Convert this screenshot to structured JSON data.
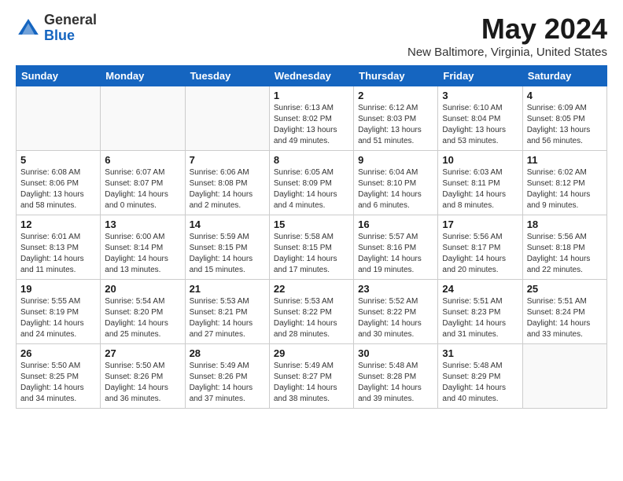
{
  "logo": {
    "general": "General",
    "blue": "Blue"
  },
  "title": "May 2024",
  "subtitle": "New Baltimore, Virginia, United States",
  "days_of_week": [
    "Sunday",
    "Monday",
    "Tuesday",
    "Wednesday",
    "Thursday",
    "Friday",
    "Saturday"
  ],
  "weeks": [
    [
      {
        "num": "",
        "info": ""
      },
      {
        "num": "",
        "info": ""
      },
      {
        "num": "",
        "info": ""
      },
      {
        "num": "1",
        "info": "Sunrise: 6:13 AM\nSunset: 8:02 PM\nDaylight: 13 hours\nand 49 minutes."
      },
      {
        "num": "2",
        "info": "Sunrise: 6:12 AM\nSunset: 8:03 PM\nDaylight: 13 hours\nand 51 minutes."
      },
      {
        "num": "3",
        "info": "Sunrise: 6:10 AM\nSunset: 8:04 PM\nDaylight: 13 hours\nand 53 minutes."
      },
      {
        "num": "4",
        "info": "Sunrise: 6:09 AM\nSunset: 8:05 PM\nDaylight: 13 hours\nand 56 minutes."
      }
    ],
    [
      {
        "num": "5",
        "info": "Sunrise: 6:08 AM\nSunset: 8:06 PM\nDaylight: 13 hours\nand 58 minutes."
      },
      {
        "num": "6",
        "info": "Sunrise: 6:07 AM\nSunset: 8:07 PM\nDaylight: 14 hours\nand 0 minutes."
      },
      {
        "num": "7",
        "info": "Sunrise: 6:06 AM\nSunset: 8:08 PM\nDaylight: 14 hours\nand 2 minutes."
      },
      {
        "num": "8",
        "info": "Sunrise: 6:05 AM\nSunset: 8:09 PM\nDaylight: 14 hours\nand 4 minutes."
      },
      {
        "num": "9",
        "info": "Sunrise: 6:04 AM\nSunset: 8:10 PM\nDaylight: 14 hours\nand 6 minutes."
      },
      {
        "num": "10",
        "info": "Sunrise: 6:03 AM\nSunset: 8:11 PM\nDaylight: 14 hours\nand 8 minutes."
      },
      {
        "num": "11",
        "info": "Sunrise: 6:02 AM\nSunset: 8:12 PM\nDaylight: 14 hours\nand 9 minutes."
      }
    ],
    [
      {
        "num": "12",
        "info": "Sunrise: 6:01 AM\nSunset: 8:13 PM\nDaylight: 14 hours\nand 11 minutes."
      },
      {
        "num": "13",
        "info": "Sunrise: 6:00 AM\nSunset: 8:14 PM\nDaylight: 14 hours\nand 13 minutes."
      },
      {
        "num": "14",
        "info": "Sunrise: 5:59 AM\nSunset: 8:15 PM\nDaylight: 14 hours\nand 15 minutes."
      },
      {
        "num": "15",
        "info": "Sunrise: 5:58 AM\nSunset: 8:15 PM\nDaylight: 14 hours\nand 17 minutes."
      },
      {
        "num": "16",
        "info": "Sunrise: 5:57 AM\nSunset: 8:16 PM\nDaylight: 14 hours\nand 19 minutes."
      },
      {
        "num": "17",
        "info": "Sunrise: 5:56 AM\nSunset: 8:17 PM\nDaylight: 14 hours\nand 20 minutes."
      },
      {
        "num": "18",
        "info": "Sunrise: 5:56 AM\nSunset: 8:18 PM\nDaylight: 14 hours\nand 22 minutes."
      }
    ],
    [
      {
        "num": "19",
        "info": "Sunrise: 5:55 AM\nSunset: 8:19 PM\nDaylight: 14 hours\nand 24 minutes."
      },
      {
        "num": "20",
        "info": "Sunrise: 5:54 AM\nSunset: 8:20 PM\nDaylight: 14 hours\nand 25 minutes."
      },
      {
        "num": "21",
        "info": "Sunrise: 5:53 AM\nSunset: 8:21 PM\nDaylight: 14 hours\nand 27 minutes."
      },
      {
        "num": "22",
        "info": "Sunrise: 5:53 AM\nSunset: 8:22 PM\nDaylight: 14 hours\nand 28 minutes."
      },
      {
        "num": "23",
        "info": "Sunrise: 5:52 AM\nSunset: 8:22 PM\nDaylight: 14 hours\nand 30 minutes."
      },
      {
        "num": "24",
        "info": "Sunrise: 5:51 AM\nSunset: 8:23 PM\nDaylight: 14 hours\nand 31 minutes."
      },
      {
        "num": "25",
        "info": "Sunrise: 5:51 AM\nSunset: 8:24 PM\nDaylight: 14 hours\nand 33 minutes."
      }
    ],
    [
      {
        "num": "26",
        "info": "Sunrise: 5:50 AM\nSunset: 8:25 PM\nDaylight: 14 hours\nand 34 minutes."
      },
      {
        "num": "27",
        "info": "Sunrise: 5:50 AM\nSunset: 8:26 PM\nDaylight: 14 hours\nand 36 minutes."
      },
      {
        "num": "28",
        "info": "Sunrise: 5:49 AM\nSunset: 8:26 PM\nDaylight: 14 hours\nand 37 minutes."
      },
      {
        "num": "29",
        "info": "Sunrise: 5:49 AM\nSunset: 8:27 PM\nDaylight: 14 hours\nand 38 minutes."
      },
      {
        "num": "30",
        "info": "Sunrise: 5:48 AM\nSunset: 8:28 PM\nDaylight: 14 hours\nand 39 minutes."
      },
      {
        "num": "31",
        "info": "Sunrise: 5:48 AM\nSunset: 8:29 PM\nDaylight: 14 hours\nand 40 minutes."
      },
      {
        "num": "",
        "info": ""
      }
    ]
  ]
}
